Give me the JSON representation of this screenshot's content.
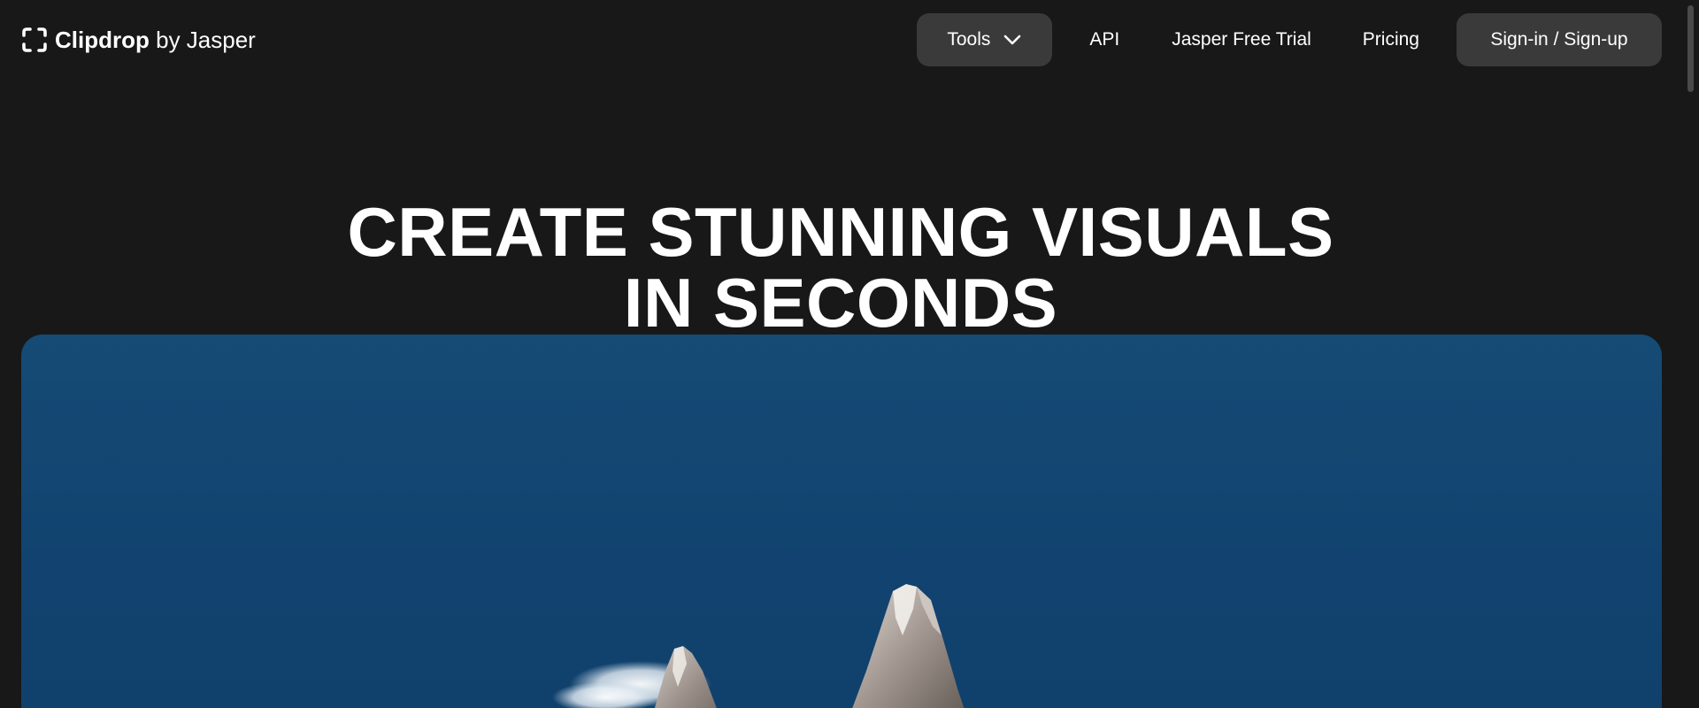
{
  "header": {
    "logo": {
      "icon": "clipdrop-bracket-icon",
      "brand": "Clipdrop",
      "by_text": "by Jasper"
    },
    "nav": {
      "tools_label": "Tools",
      "tools_icon": "chevron-down-icon",
      "api_label": "API",
      "trial_label": "Jasper Free Trial",
      "pricing_label": "Pricing",
      "signin_label": "Sign-in / Sign-up"
    }
  },
  "hero": {
    "title_line1": "CREATE STUNNING VISUALS",
    "title_line2": "IN SECONDS",
    "image": "mountain-peaks-sky-image"
  },
  "colors": {
    "background": "#181818",
    "button_bg": "#3a3a3a",
    "text": "#ffffff",
    "sky": "#134570"
  }
}
